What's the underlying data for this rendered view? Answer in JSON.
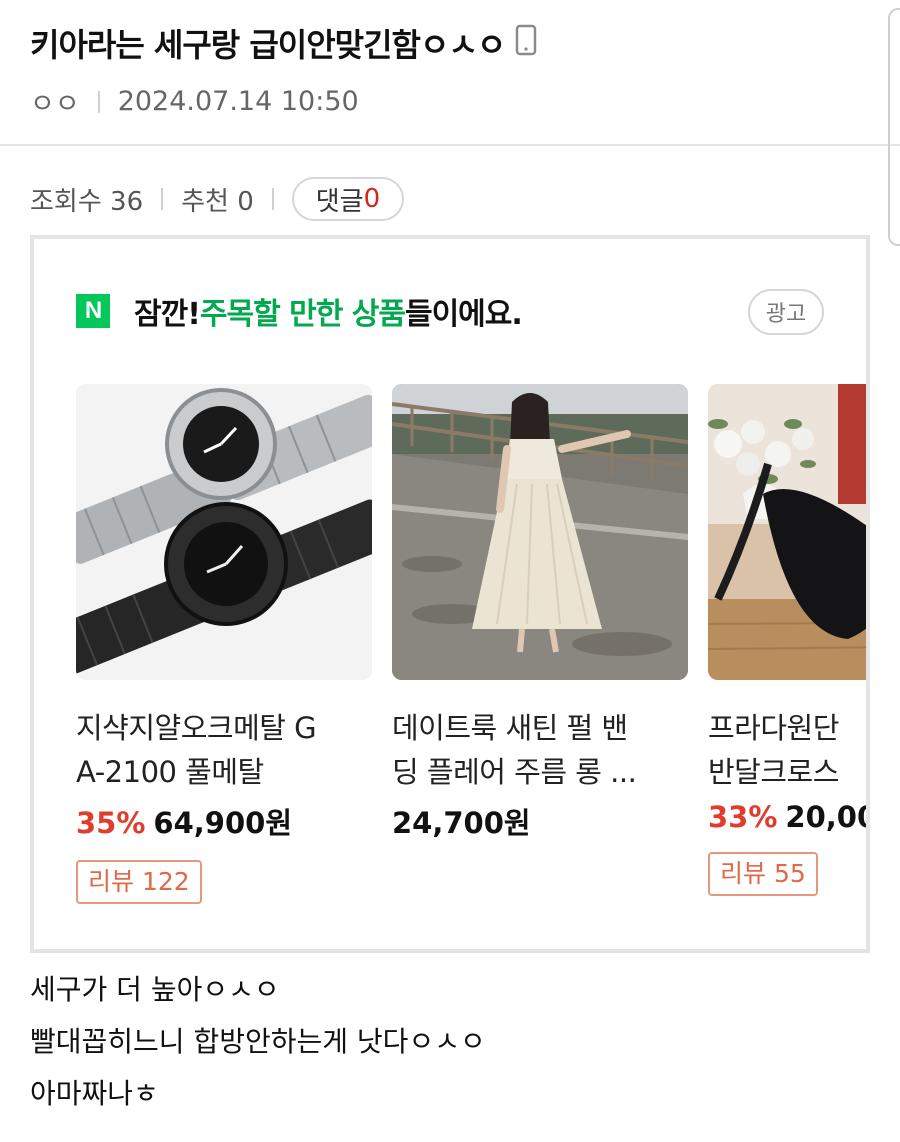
{
  "post": {
    "title": "키아라는 세구랑 급이안맞긴함ㅇㅅㅇ",
    "device_icon": "mobile-phone-icon",
    "author": "ㅇㅇ",
    "datetime": "2024.07.14 10:50"
  },
  "stats": {
    "views_label": "조회수 36",
    "recommend_label": "추천 0",
    "comments_label": "댓글",
    "comments_count": "0"
  },
  "ad": {
    "logo_letter": "N",
    "heading_pre": "잠깐! ",
    "heading_highlight": "주목할 만한 상품",
    "heading_post": "들이에요.",
    "badge": "광고",
    "products": [
      {
        "name_line1": "지샥지얄오크메탈 G",
        "name_line2": "A-2100 풀메탈",
        "discount": "35%",
        "price": "64,900원",
        "review": "리뷰 122",
        "image": "watch-image"
      },
      {
        "name_line1": "데이트룩 새틴 펄 밴",
        "name_line2": "딩 플레어 주름 롱 ...",
        "discount": "",
        "price": "24,700원",
        "review": "",
        "image": "dress-image"
      },
      {
        "name_line1": "프라다원단",
        "name_line2": "반달크로스",
        "discount": "33%",
        "price": "20,00",
        "review": "리뷰 55",
        "image": "bag-image"
      }
    ]
  },
  "body": {
    "line1": "세구가 더 높아ㅇㅅㅇ",
    "line2": "빨대꼽히느니 합방안하는게 낫다ㅇㅅㅇ",
    "line3": "아마짜나ㅎ"
  },
  "colors": {
    "naver_green": "#03c75a",
    "highlight_green": "#03a94e",
    "discount_red": "#e03e2d",
    "comment_red": "#d2271a",
    "review_orange": "#e06a48"
  }
}
